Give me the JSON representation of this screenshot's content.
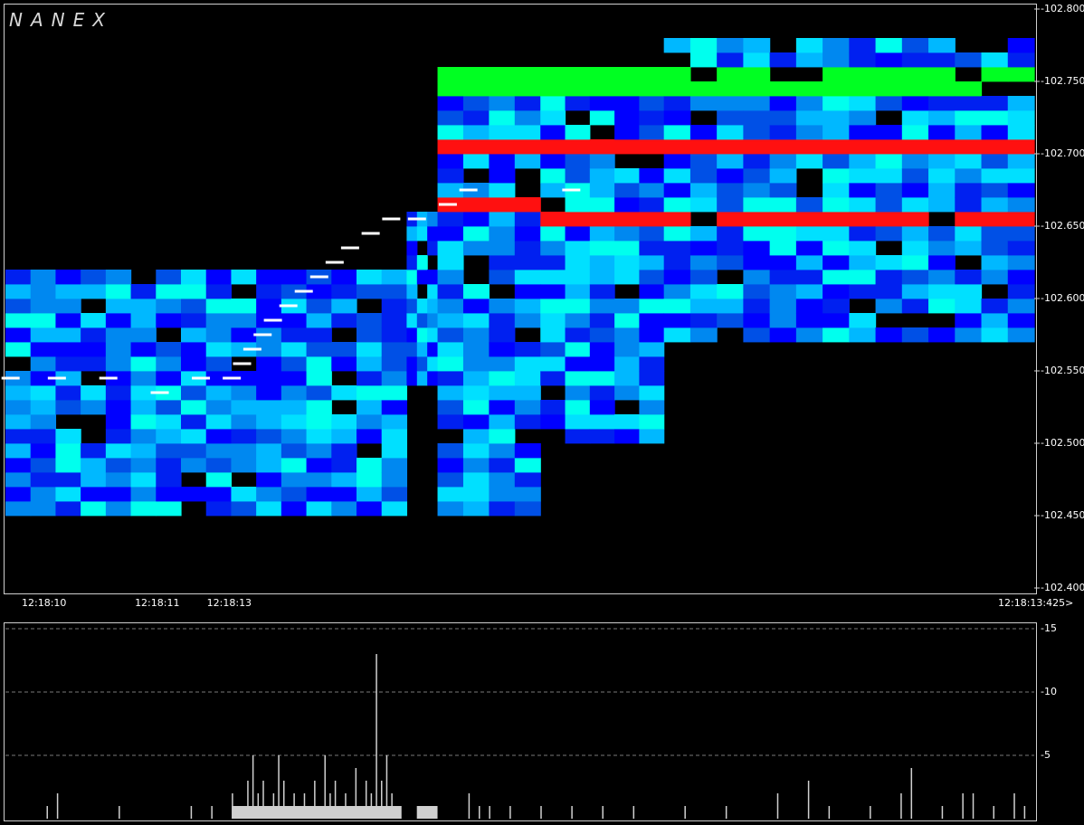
{
  "logo": "NANEX",
  "colors": {
    "background": "#000000",
    "frame": "#cfcfcf",
    "bid_best": "#00ff22",
    "ask_best": "#ff1010",
    "trade": "#ffffff",
    "volume": "#d0d0d0",
    "depth_scale": [
      "#0000ff",
      "#0020f0",
      "#0050e6",
      "#0088f0",
      "#00b8ff",
      "#00e0ff",
      "#00ffee"
    ]
  },
  "chart_data": [
    {
      "type": "heatmap",
      "title": "",
      "xlabel": "",
      "ylabel": "",
      "x_tick_labels": [
        "12:18:10",
        "12:18:11",
        "12:18:13",
        "12:18:13:425>"
      ],
      "y_tick_labels": [
        "102.800",
        "102.750",
        "102.700",
        "102.650",
        "102.600",
        "102.550",
        "102.500",
        "102.450",
        "102.400"
      ],
      "ylim": [
        102.4,
        102.8
      ],
      "grid": false,
      "price_step": 0.01,
      "time_fraction_ticks": [
        0,
        0.11,
        0.18,
        1.0
      ],
      "segments": [
        {
          "t": [
            0.0,
            0.39
          ],
          "low": 102.45,
          "high": 102.62,
          "bid": 102.54,
          "ask": null
        },
        {
          "t": [
            0.39,
            0.42
          ],
          "low": 102.54,
          "high": 102.66,
          "bid": 102.66,
          "ask": 102.7
        },
        {
          "t": [
            0.42,
            0.52
          ],
          "low": 102.45,
          "high": 102.76,
          "bid": 102.67,
          "ask": 102.7
        },
        {
          "t": [
            0.52,
            0.64
          ],
          "low": 102.5,
          "high": 102.76,
          "bid": 102.66,
          "ask": 102.7
        },
        {
          "t": [
            0.64,
            1.0
          ],
          "low": 102.57,
          "high": 102.78,
          "bid": 102.66,
          "ask": 102.7
        }
      ],
      "trades": [
        {
          "t": 0.005,
          "price": 102.545
        },
        {
          "t": 0.05,
          "price": 102.545
        },
        {
          "t": 0.1,
          "price": 102.545
        },
        {
          "t": 0.15,
          "price": 102.535
        },
        {
          "t": 0.19,
          "price": 102.545
        },
        {
          "t": 0.22,
          "price": 102.545
        },
        {
          "t": 0.23,
          "price": 102.555
        },
        {
          "t": 0.24,
          "price": 102.565
        },
        {
          "t": 0.25,
          "price": 102.575
        },
        {
          "t": 0.26,
          "price": 102.585
        },
        {
          "t": 0.275,
          "price": 102.595
        },
        {
          "t": 0.29,
          "price": 102.605
        },
        {
          "t": 0.305,
          "price": 102.615
        },
        {
          "t": 0.32,
          "price": 102.625
        },
        {
          "t": 0.335,
          "price": 102.635
        },
        {
          "t": 0.355,
          "price": 102.645
        },
        {
          "t": 0.375,
          "price": 102.655
        },
        {
          "t": 0.4,
          "price": 102.655
        },
        {
          "t": 0.43,
          "price": 102.665
        },
        {
          "t": 0.45,
          "price": 102.675
        },
        {
          "t": 0.55,
          "price": 102.675
        }
      ]
    },
    {
      "type": "bar",
      "title": "",
      "xlabel": "",
      "ylabel": "",
      "ylim": [
        0,
        15
      ],
      "y_tick_labels": [
        "15",
        "10",
        "5"
      ],
      "grid": true,
      "bars": [
        {
          "t": 0.04,
          "v": 1
        },
        {
          "t": 0.05,
          "v": 2
        },
        {
          "t": 0.11,
          "v": 1
        },
        {
          "t": 0.18,
          "v": 1
        },
        {
          "t": 0.2,
          "v": 1
        },
        {
          "t": 0.22,
          "v": 2
        },
        {
          "t": 0.23,
          "v": 1
        },
        {
          "t": 0.235,
          "v": 3
        },
        {
          "t": 0.24,
          "v": 5
        },
        {
          "t": 0.245,
          "v": 2
        },
        {
          "t": 0.25,
          "v": 3
        },
        {
          "t": 0.26,
          "v": 2
        },
        {
          "t": 0.265,
          "v": 5
        },
        {
          "t": 0.27,
          "v": 3
        },
        {
          "t": 0.28,
          "v": 2
        },
        {
          "t": 0.29,
          "v": 2
        },
        {
          "t": 0.3,
          "v": 3
        },
        {
          "t": 0.31,
          "v": 5
        },
        {
          "t": 0.315,
          "v": 2
        },
        {
          "t": 0.32,
          "v": 3
        },
        {
          "t": 0.33,
          "v": 2
        },
        {
          "t": 0.34,
          "v": 4
        },
        {
          "t": 0.35,
          "v": 3
        },
        {
          "t": 0.355,
          "v": 2
        },
        {
          "t": 0.36,
          "v": 13
        },
        {
          "t": 0.365,
          "v": 3
        },
        {
          "t": 0.37,
          "v": 5
        },
        {
          "t": 0.375,
          "v": 2
        },
        {
          "t": 0.4,
          "v": 1
        },
        {
          "t": 0.41,
          "v": 1
        },
        {
          "t": 0.45,
          "v": 2
        },
        {
          "t": 0.46,
          "v": 1
        },
        {
          "t": 0.47,
          "v": 1
        },
        {
          "t": 0.49,
          "v": 1
        },
        {
          "t": 0.52,
          "v": 1
        },
        {
          "t": 0.55,
          "v": 1
        },
        {
          "t": 0.58,
          "v": 1
        },
        {
          "t": 0.61,
          "v": 1
        },
        {
          "t": 0.66,
          "v": 1
        },
        {
          "t": 0.7,
          "v": 1
        },
        {
          "t": 0.75,
          "v": 2
        },
        {
          "t": 0.78,
          "v": 3
        },
        {
          "t": 0.8,
          "v": 1
        },
        {
          "t": 0.84,
          "v": 1
        },
        {
          "t": 0.87,
          "v": 2
        },
        {
          "t": 0.88,
          "v": 4
        },
        {
          "t": 0.91,
          "v": 1
        },
        {
          "t": 0.93,
          "v": 2
        },
        {
          "t": 0.94,
          "v": 2
        },
        {
          "t": 0.96,
          "v": 1
        },
        {
          "t": 0.98,
          "v": 2
        },
        {
          "t": 0.99,
          "v": 1
        }
      ],
      "dense_runs": [
        {
          "t": [
            0.22,
            0.385
          ],
          "v": 1
        },
        {
          "t": [
            0.4,
            0.42
          ],
          "v": 1
        }
      ]
    }
  ]
}
